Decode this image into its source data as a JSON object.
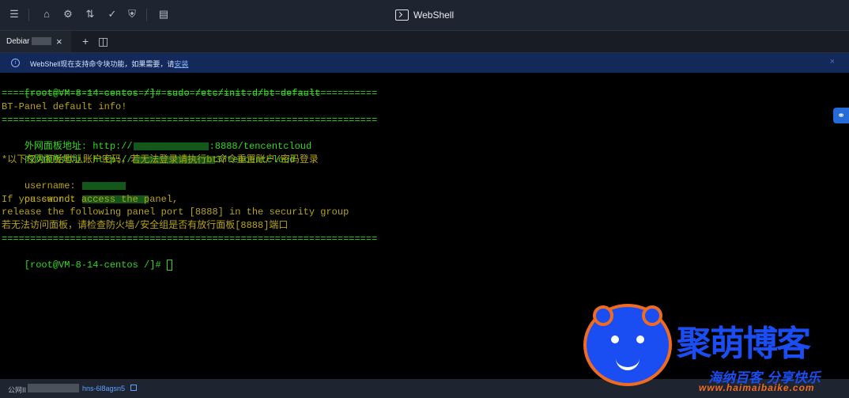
{
  "window": {
    "title": "WebShell"
  },
  "toolbar": {
    "icons": [
      "server-icon",
      "folder-icon",
      "settings-icon",
      "transfer-icon",
      "file-check-icon",
      "shield-icon",
      "layout-icon"
    ]
  },
  "tabs": [
    {
      "label": "Debiar",
      "active": true
    }
  ],
  "tab_actions": {
    "add_label": "+",
    "split_label": "◫"
  },
  "notice": {
    "text_prefix": "WebShell现在支持命令块功能，如果需要，请",
    "link_text": "安装",
    "close_label": "×"
  },
  "terminal": {
    "lines": [
      {
        "type": "prompt",
        "prompt": "[root@VM-8-14-centos /]#",
        "text": " sudo /etc/init.d/bt default"
      },
      {
        "type": "text",
        "text": "=================================================================="
      },
      {
        "type": "text",
        "text": "BT-Panel default info!"
      },
      {
        "type": "text",
        "text": "=================================================================="
      },
      {
        "type": "ip",
        "prefix": "外网面板地址: http://",
        "suffix": ":8888/tencentcloud"
      },
      {
        "type": "ip",
        "prefix": "内网面板地址: http://",
        "suffix": "3/tencentcloud"
      },
      {
        "type": "warn",
        "text": "*以下仅为初始默认账户密码，若无法登录请执行bt命令重置账户/密码登录"
      },
      {
        "type": "secret",
        "text": "username: "
      },
      {
        "type": "secret",
        "text": "password: "
      },
      {
        "type": "warn",
        "text": "If you cannot access the panel,"
      },
      {
        "type": "warn",
        "text": "release the following panel port [8888] in the security group"
      },
      {
        "type": "warn",
        "text": "若无法访问面板，请检查防火墙/安全组是否有放行面板[8888]端口"
      },
      {
        "type": "text",
        "text": "=================================================================="
      },
      {
        "type": "prompt",
        "prompt": "[root@VM-8-14-centos /]#",
        "text": " "
      }
    ]
  },
  "statusbar": {
    "label": "公网II",
    "link_text": "hns-6l8agsn5"
  },
  "watermark": {
    "title": "聚萌博客",
    "subtitle": "海纳百客 分享快乐",
    "url": "www.haimaibaike.com"
  }
}
